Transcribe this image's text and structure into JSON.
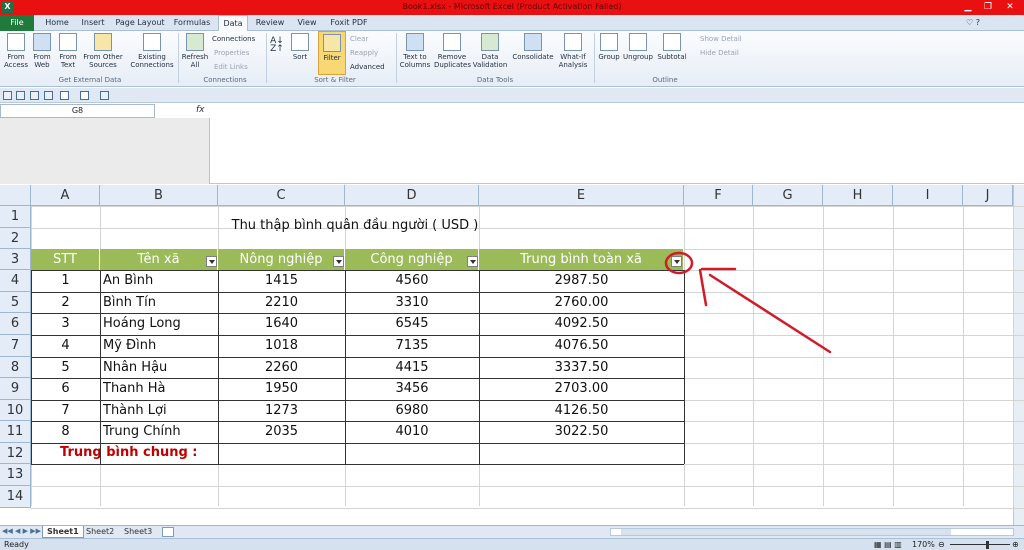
{
  "window": {
    "title": "Book1.xlsx - Microsoft Excel (Product Activation Failed)",
    "app_icon": "X"
  },
  "tabs": [
    "File",
    "Home",
    "Insert",
    "Page Layout",
    "Formulas",
    "Data",
    "Review",
    "View",
    "Foxit PDF"
  ],
  "ribbon": {
    "get_external": {
      "label": "Get External Data",
      "buttons": [
        "From Access",
        "From Web",
        "From Text",
        "From Other Sources",
        "Existing Connections"
      ]
    },
    "connections": {
      "label": "Connections",
      "refresh": "Refresh All",
      "items": [
        "Connections",
        "Properties",
        "Edit Links"
      ]
    },
    "sort_filter": {
      "label": "Sort & Filter",
      "sort": "Sort",
      "filter": "Filter",
      "clear": "Clear",
      "reapply": "Reapply",
      "advanced": "Advanced"
    },
    "data_tools": {
      "label": "Data Tools",
      "buttons": [
        "Text to Columns",
        "Remove Duplicates",
        "Data Validation",
        "Consolidate",
        "What-If Analysis"
      ]
    },
    "outline": {
      "label": "Outline",
      "buttons": [
        "Group",
        "Ungroup",
        "Subtotal"
      ],
      "show_detail": "Show Detail",
      "hide_detail": "Hide Detail"
    }
  },
  "formula_bar": {
    "name_box": "G8",
    "fx": "fx",
    "value": ""
  },
  "columns": [
    "A",
    "B",
    "C",
    "D",
    "E",
    "F",
    "G",
    "H",
    "I",
    "J"
  ],
  "rows": [
    "1",
    "2",
    "3",
    "4",
    "5",
    "6",
    "7",
    "8",
    "9",
    "10",
    "11",
    "12",
    "13",
    "14"
  ],
  "sheet": {
    "title": "Thu thập bình quân đầu người ( USD )",
    "headers": [
      "STT",
      "Tên xã",
      "Nông nghiệp",
      "Công nghiệp",
      "Trung bình toàn xã"
    ],
    "data": [
      [
        "1",
        "An Bình",
        "1415",
        "4560",
        "2987.50"
      ],
      [
        "2",
        "Bình Tín",
        "2210",
        "3310",
        "2760.00"
      ],
      [
        "3",
        "Hoáng Long",
        "1640",
        "6545",
        "4092.50"
      ],
      [
        "4",
        "Mỹ Đình",
        "1018",
        "7135",
        "4076.50"
      ],
      [
        "5",
        "Nhân Hậu",
        "2260",
        "4415",
        "3337.50"
      ],
      [
        "6",
        "Thanh Hà",
        "1950",
        "3456",
        "2703.00"
      ],
      [
        "7",
        "Thành Lợi",
        "1273",
        "6980",
        "4126.50"
      ],
      [
        "8",
        "Trung Chính",
        "2035",
        "4010",
        "3022.50"
      ]
    ],
    "summary_label": "Trung bình chung :"
  },
  "sheet_tabs": [
    "Sheet1",
    "Sheet2",
    "Sheet3"
  ],
  "status": {
    "ready": "Ready",
    "zoom": "170%"
  },
  "colors": {
    "header_green": "#9bbb59",
    "summary_red": "#c00000",
    "annotation_red": "#d11a2a"
  }
}
